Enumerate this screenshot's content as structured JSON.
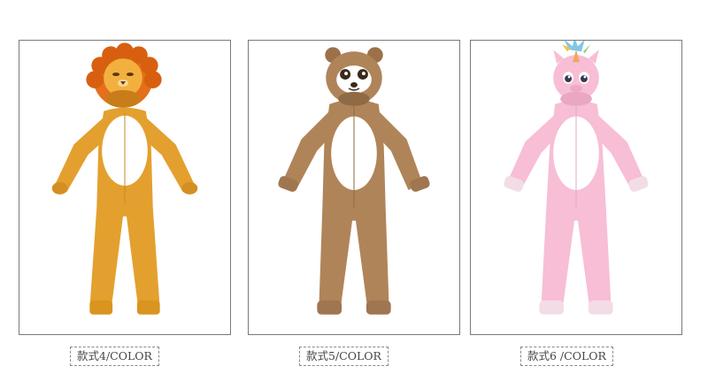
{
  "products": [
    {
      "label": "款式4/COLOR",
      "character": "lion",
      "icon": "lion-onesie-icon",
      "color": "#e3a02e"
    },
    {
      "label": "款式5/COLOR",
      "character": "bear",
      "icon": "bear-onesie-icon",
      "color": "#b08459"
    },
    {
      "label": "款式6 /COLOR",
      "character": "unicorn",
      "icon": "unicorn-onesie-icon",
      "color": "#f7bed6"
    }
  ]
}
